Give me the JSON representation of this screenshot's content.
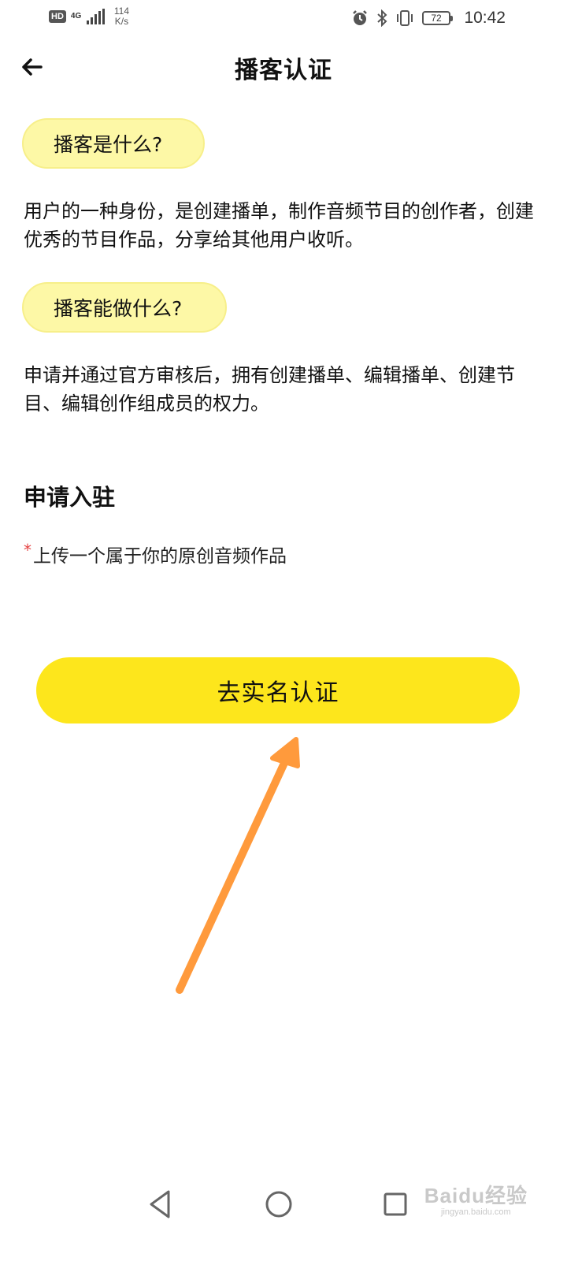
{
  "status_bar": {
    "hd_label": "HD",
    "network_type": "4G",
    "speed_value": "114",
    "speed_unit": "K/s",
    "battery_level": "72",
    "time": "10:42",
    "icons": [
      "alarm-icon",
      "bluetooth-icon",
      "vibrate-icon",
      "battery-icon"
    ]
  },
  "header": {
    "back_icon": "arrow-left-icon",
    "title": "播客认证"
  },
  "sections": [
    {
      "heading": "播客是什么?",
      "body": "用户的一种身份，是创建播单，制作音频节目的创作者，创建优秀的节目作品，分享给其他用户收听。"
    },
    {
      "heading": "播客能做什么?",
      "body": "申请并通过官方审核后，拥有创建播单、编辑播单、创建节目、编辑创作组成员的权力。"
    }
  ],
  "apply": {
    "title": "申请入驻",
    "required_mark": "*",
    "requirement": "上传一个属于你的原创音频作品",
    "button_label": "去实名认证"
  },
  "annotation": {
    "type": "arrow",
    "color": "#ff9a3c",
    "points_to": "real-name-auth-button"
  },
  "nav_bar": {
    "icons": [
      "triangle-back-icon",
      "circle-home-icon",
      "square-recent-icon"
    ]
  },
  "watermark": {
    "main": "Baidu经验",
    "sub": "jingyan.baidu.com"
  },
  "colors": {
    "accent_yellow": "#fde61c",
    "pill_yellow": "#fdf8a6",
    "required_red": "#e54444"
  }
}
